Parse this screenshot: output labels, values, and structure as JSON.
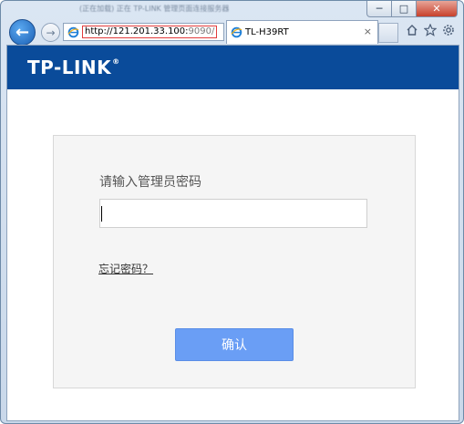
{
  "browser": {
    "title_bar_text": "(正在加载) 正在 TP-LINK 管理页面连接服务器",
    "address_url_main": "http://121.201.33.100:",
    "address_url_port": "9090/",
    "tab_title": "TL-H39RT",
    "tab_close_glyph": "×",
    "back_glyph": "←",
    "forward_glyph": "→",
    "win_minimize_glyph": "─",
    "win_maximize_glyph": "□",
    "win_close_glyph": "✕",
    "icons": [
      "ie-page-icon",
      "home-icon",
      "favorites-star-icon",
      "gear-icon"
    ]
  },
  "header": {
    "logo_text": "TP-LINK",
    "logo_reg": "®",
    "bar_color": "#0a4b9a"
  },
  "login": {
    "label": "请输入管理员密码",
    "password_value": "",
    "forgot_link": "忘记密码？",
    "confirm_button": "确认",
    "button_color": "#6a9ef5"
  }
}
